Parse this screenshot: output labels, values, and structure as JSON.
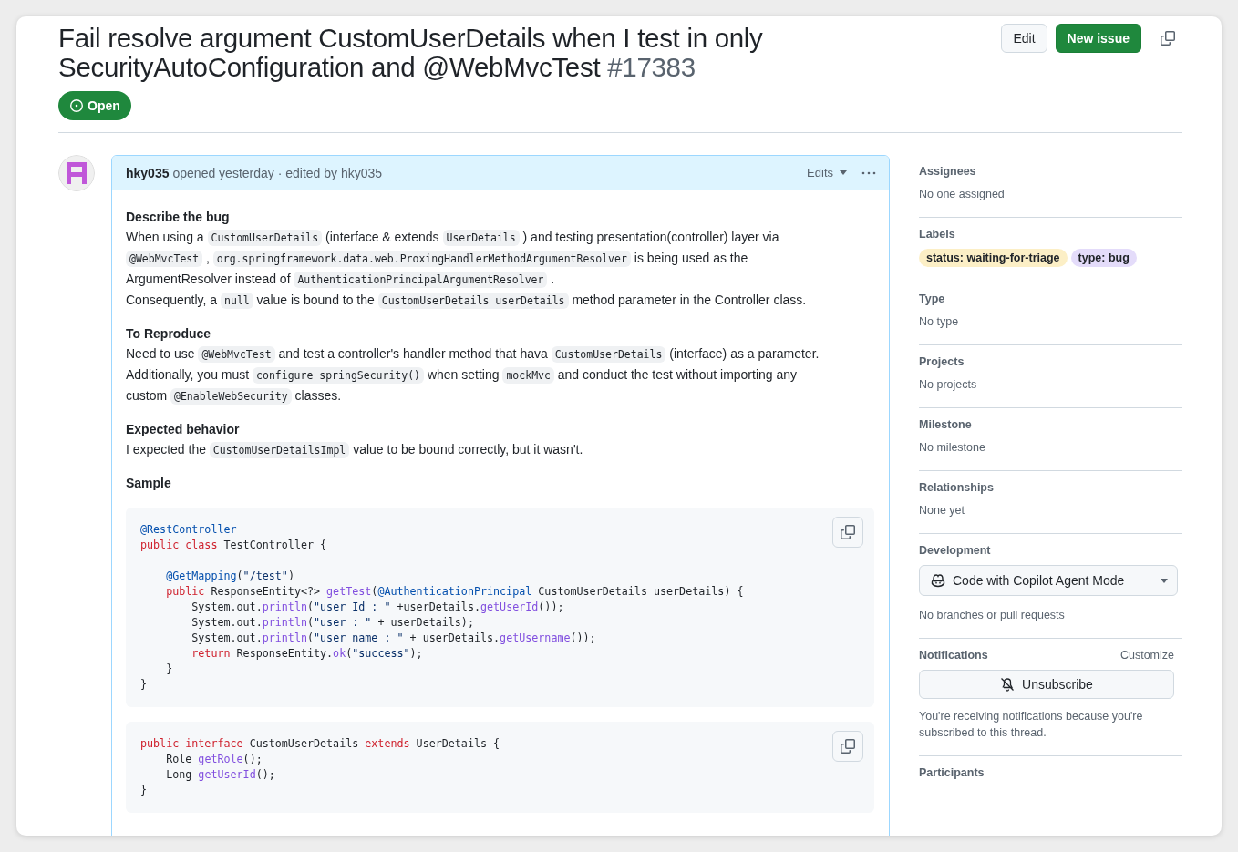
{
  "issue": {
    "title": "Fail resolve argument CustomUserDetails when I test in only SecurityAutoConfiguration and @WebMvcTest",
    "number": "#17383",
    "state": "Open"
  },
  "actions": {
    "edit": "Edit",
    "new_issue": "New issue"
  },
  "comment": {
    "author": "hky035",
    "meta": "opened yesterday · edited by hky035",
    "edits": "Edits",
    "blocks": [
      {
        "kind": "heading",
        "text": "Describe the bug"
      },
      {
        "kind": "paragraph",
        "lines": [
          [
            {
              "kind": "text",
              "text": "When using a "
            },
            {
              "kind": "code",
              "text": "CustomUserDetails"
            },
            {
              "kind": "text",
              "text": " (interface & extends "
            },
            {
              "kind": "code",
              "text": "UserDetails"
            },
            {
              "kind": "text",
              "text": " ) and testing presentation(controller) layer via"
            }
          ],
          [
            {
              "kind": "code",
              "text": "@WebMvcTest"
            },
            {
              "kind": "text",
              "text": " , "
            },
            {
              "kind": "code",
              "text": "org.springframework.data.web.ProxingHandlerMethodArgumentResolver"
            },
            {
              "kind": "text",
              "text": " is being used as the"
            }
          ],
          [
            {
              "kind": "text",
              "text": "ArgumentResolver instead of "
            },
            {
              "kind": "code",
              "text": "AuthenticationPrincipalArgumentResolver"
            },
            {
              "kind": "text",
              "text": " ."
            }
          ],
          [
            {
              "kind": "text",
              "text": "Consequently, a "
            },
            {
              "kind": "code",
              "text": "null"
            },
            {
              "kind": "text",
              "text": " value is bound to the "
            },
            {
              "kind": "code",
              "text": "CustomUserDetails userDetails"
            },
            {
              "kind": "text",
              "text": " method parameter in the Controller class."
            }
          ]
        ]
      },
      {
        "kind": "heading",
        "text": "To Reproduce"
      },
      {
        "kind": "paragraph",
        "lines": [
          [
            {
              "kind": "text",
              "text": "Need to use "
            },
            {
              "kind": "code",
              "text": "@WebMvcTest"
            },
            {
              "kind": "text",
              "text": " and test a controller's handler method that hava "
            },
            {
              "kind": "code",
              "text": "CustomUserDetails"
            },
            {
              "kind": "text",
              "text": " (interface) as a parameter."
            }
          ],
          [
            {
              "kind": "text",
              "text": "Additionally, you must "
            },
            {
              "kind": "code",
              "text": "configure springSecurity()"
            },
            {
              "kind": "text",
              "text": " when setting "
            },
            {
              "kind": "code",
              "text": "mockMvc"
            },
            {
              "kind": "text",
              "text": " and conduct the test without importing any"
            }
          ],
          [
            {
              "kind": "text",
              "text": "custom "
            },
            {
              "kind": "code",
              "text": "@EnableWebSecurity"
            },
            {
              "kind": "text",
              "text": " classes."
            }
          ]
        ]
      },
      {
        "kind": "heading",
        "text": "Expected behavior"
      },
      {
        "kind": "paragraph",
        "lines": [
          [
            {
              "kind": "text",
              "text": "I expected the "
            },
            {
              "kind": "code",
              "text": "CustomUserDetailsImpl"
            },
            {
              "kind": "text",
              "text": " value to be bound correctly, but it wasn't."
            }
          ]
        ]
      },
      {
        "kind": "heading",
        "text": "Sample"
      },
      {
        "kind": "codeblock",
        "groups": [
          [
            [
              {
                "kind": "annotation",
                "text": "@RestController"
              }
            ],
            [
              {
                "kind": "keyword",
                "text": "public class"
              },
              {
                "kind": "plain",
                "text": " TestController {"
              }
            ]
          ],
          [
            [
              {
                "kind": "annotation",
                "text": "    @GetMapping"
              },
              {
                "kind": "plain",
                "text": "("
              },
              {
                "kind": "string",
                "text": "\"/test\""
              },
              {
                "kind": "plain",
                "text": ")"
              }
            ],
            [
              {
                "kind": "keyword",
                "text": "    public"
              },
              {
                "kind": "plain",
                "text": " ResponseEntity<?> "
              },
              {
                "kind": "method",
                "text": "getTest"
              },
              {
                "kind": "plain",
                "text": "("
              },
              {
                "kind": "annotation",
                "text": "@AuthenticationPrincipal"
              },
              {
                "kind": "plain",
                "text": " CustomUserDetails userDetails) {"
              }
            ],
            [
              {
                "kind": "plain",
                "text": "        System.out."
              },
              {
                "kind": "method",
                "text": "println"
              },
              {
                "kind": "plain",
                "text": "("
              },
              {
                "kind": "string",
                "text": "\"user Id : \""
              },
              {
                "kind": "plain",
                "text": " +userDetails."
              },
              {
                "kind": "method",
                "text": "getUserId"
              },
              {
                "kind": "plain",
                "text": "());"
              }
            ],
            [
              {
                "kind": "plain",
                "text": "        System.out."
              },
              {
                "kind": "method",
                "text": "println"
              },
              {
                "kind": "plain",
                "text": "("
              },
              {
                "kind": "string",
                "text": "\"user : \""
              },
              {
                "kind": "plain",
                "text": " + userDetails);"
              }
            ],
            [
              {
                "kind": "plain",
                "text": "        System.out."
              },
              {
                "kind": "method",
                "text": "println"
              },
              {
                "kind": "plain",
                "text": "("
              },
              {
                "kind": "string",
                "text": "\"user name : \""
              },
              {
                "kind": "plain",
                "text": " + userDetails."
              },
              {
                "kind": "method",
                "text": "getUsername"
              },
              {
                "kind": "plain",
                "text": "());"
              }
            ],
            [
              {
                "kind": "keyword",
                "text": "        return"
              },
              {
                "kind": "plain",
                "text": " ResponseEntity."
              },
              {
                "kind": "method",
                "text": "ok"
              },
              {
                "kind": "plain",
                "text": "("
              },
              {
                "kind": "string",
                "text": "\"success\""
              },
              {
                "kind": "plain",
                "text": ");"
              }
            ],
            [
              {
                "kind": "plain",
                "text": "    }"
              }
            ],
            [
              {
                "kind": "plain",
                "text": "}"
              }
            ]
          ]
        ]
      },
      {
        "kind": "codeblock",
        "groups": [
          [
            [
              {
                "kind": "keyword",
                "text": "public interface"
              },
              {
                "kind": "plain",
                "text": " CustomUserDetails "
              },
              {
                "kind": "keyword",
                "text": "extends"
              },
              {
                "kind": "plain",
                "text": " UserDetails {"
              }
            ],
            [
              {
                "kind": "plain",
                "text": "    Role "
              },
              {
                "kind": "method",
                "text": "getRole"
              },
              {
                "kind": "plain",
                "text": "();"
              }
            ],
            [
              {
                "kind": "plain",
                "text": "    Long "
              },
              {
                "kind": "method",
                "text": "getUserId"
              },
              {
                "kind": "plain",
                "text": "();"
              }
            ],
            [
              {
                "kind": "plain",
                "text": "}"
              }
            ]
          ]
        ]
      }
    ]
  },
  "sidebar": [
    {
      "kind": "text",
      "heading": "Assignees",
      "value": "No one assigned"
    },
    {
      "kind": "labels",
      "heading": "Labels",
      "labels": [
        {
          "text": "status: waiting-for-triage",
          "color": "#fcefc6"
        },
        {
          "text": "type: bug",
          "color": "#e4dcfa"
        }
      ]
    },
    {
      "kind": "text",
      "heading": "Type",
      "value": "No type"
    },
    {
      "kind": "text",
      "heading": "Projects",
      "value": "No projects"
    },
    {
      "kind": "text",
      "heading": "Milestone",
      "value": "No milestone"
    },
    {
      "kind": "text",
      "heading": "Relationships",
      "value": "None yet"
    },
    {
      "kind": "development",
      "heading": "Development",
      "button": "Code with Copilot Agent Mode",
      "value": "No branches or pull requests"
    },
    {
      "kind": "notifications",
      "heading": "Notifications",
      "action": "Customize",
      "button": "Unsubscribe",
      "value": "You're receiving notifications because you're subscribed to this thread."
    },
    {
      "kind": "heading",
      "heading": "Participants"
    }
  ]
}
